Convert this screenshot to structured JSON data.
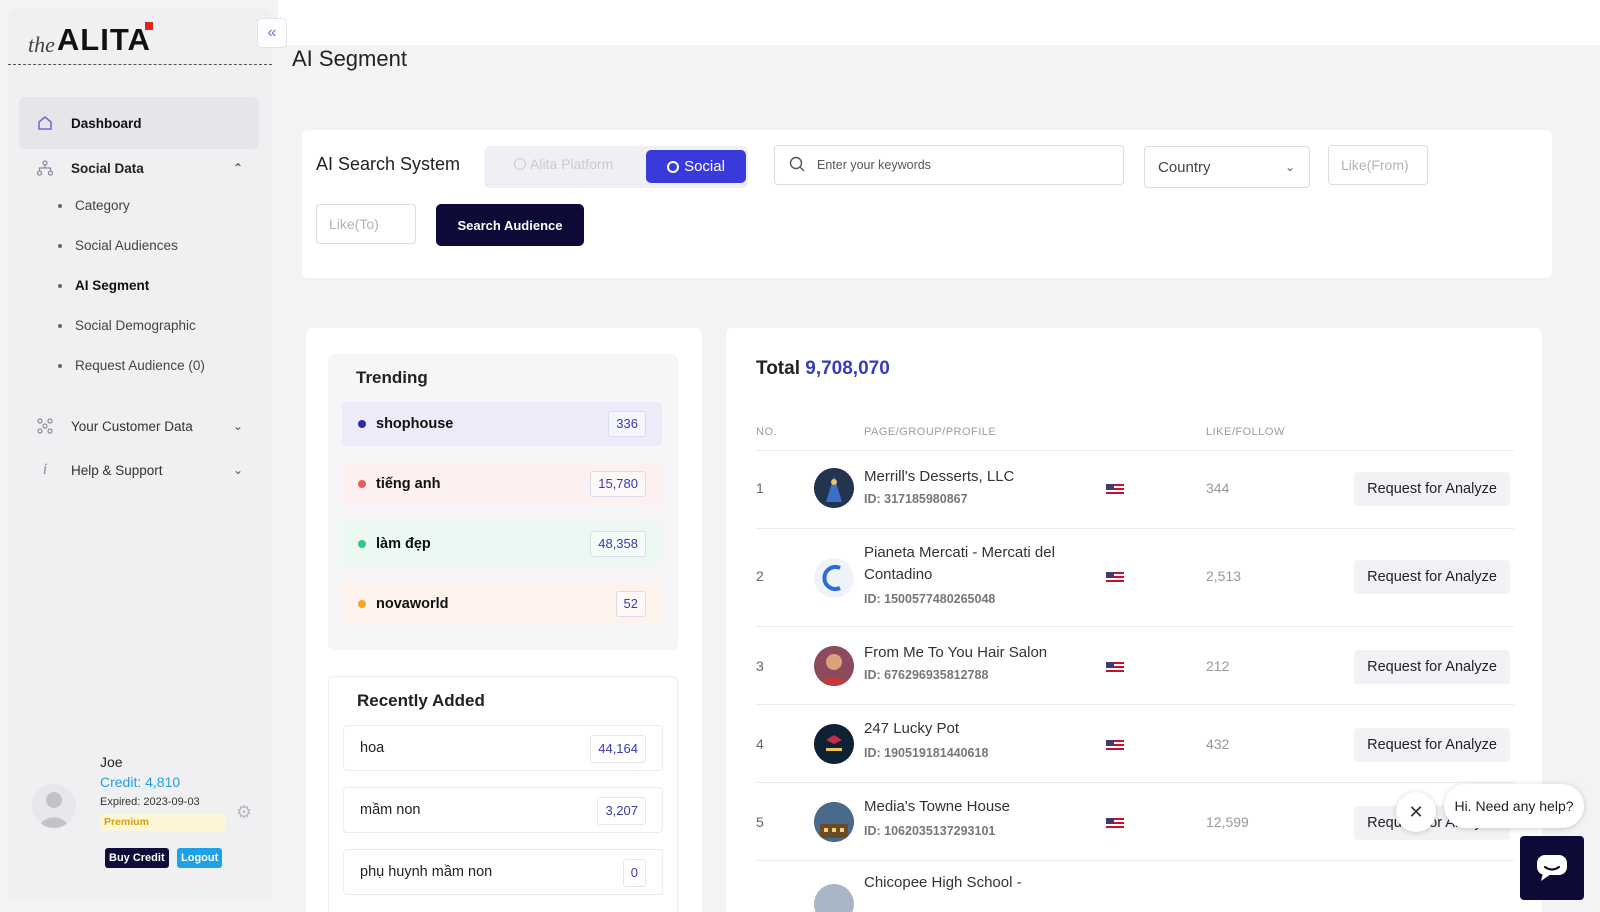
{
  "brand": {
    "prefix": "the",
    "name": "ALITA"
  },
  "sidebar": {
    "dashboard": "Dashboard",
    "social_data": "Social Data",
    "social_sub": [
      "Category",
      "Social Audiences",
      "AI Segment",
      "Social Demographic",
      "Request Audience (0)"
    ],
    "customer_data": "Your Customer Data",
    "help": "Help & Support"
  },
  "user": {
    "name": "Joe",
    "credit": "Credit: 4,810",
    "expired": "Expired: 2023-09-03",
    "plan": "Premium",
    "buy_label": "Buy Credit",
    "logout_label": "Logout"
  },
  "page": {
    "title": "AI Segment"
  },
  "search": {
    "title": "AI Search System",
    "option_platform": "Alita Platform",
    "option_social": "Social",
    "keyword_placeholder": "Enter your keywords",
    "country_label": "Country",
    "like_from": "Like(From)",
    "like_to": "Like(To)",
    "button_label": "Search Audience"
  },
  "trending": {
    "title": "Trending",
    "items": [
      {
        "label": "shophouse",
        "count": "336",
        "dot": "#2b2ba6",
        "bg": "#ebebfa"
      },
      {
        "label": "tiếng anh",
        "count": "15,780",
        "dot": "#ef5a5a",
        "bg": "#fdf0f0"
      },
      {
        "label": "làm đẹp",
        "count": "48,358",
        "dot": "#2ec78a",
        "bg": "#ecf8f2"
      },
      {
        "label": "novaworld",
        "count": "52",
        "dot": "#f5a623",
        "bg": "#fdf3ec"
      }
    ]
  },
  "recent": {
    "title": "Recently Added",
    "items": [
      {
        "label": "hoa",
        "count": "44,164"
      },
      {
        "label": "mầm non",
        "count": "3,207"
      },
      {
        "label": "phụ huynh mầm non",
        "count": "0"
      }
    ]
  },
  "results": {
    "total_label": "Total",
    "total_value": "9,708,070",
    "headers": {
      "no": "NO.",
      "page": "PAGE/GROUP/PROFILE",
      "likes": "LIKE/FOLLOW"
    },
    "request_label": "Request for Analyze",
    "rows": [
      {
        "no": "1",
        "name": "Merrill's Desserts, LLC",
        "id": "ID: 317185980867",
        "likes": "344"
      },
      {
        "no": "2",
        "name": "Pianeta Mercati - Mercati del Contadino",
        "id": "ID: 1500577480265048",
        "likes": "2,513"
      },
      {
        "no": "3",
        "name": "From Me To You Hair Salon",
        "id": "ID: 676296935812788",
        "likes": "212"
      },
      {
        "no": "4",
        "name": "247 Lucky Pot",
        "id": "ID: 190519181440618",
        "likes": "432"
      },
      {
        "no": "5",
        "name": "Media's Towne House",
        "id": "ID: 1062035137293101",
        "likes": "12,599"
      },
      {
        "no": "",
        "name": "Chicopee High School -",
        "id": "",
        "likes": ""
      }
    ]
  },
  "chat": {
    "greeting": "Hi. Need any help?"
  }
}
